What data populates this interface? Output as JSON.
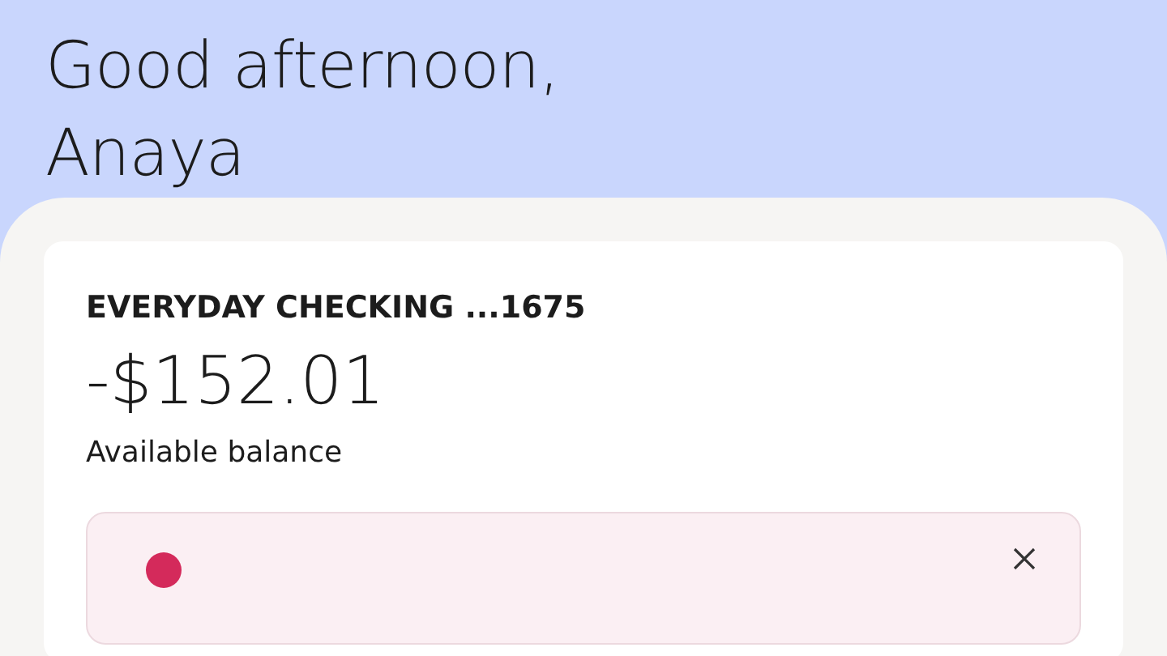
{
  "greeting": {
    "lines": [
      "Good afternoon,",
      "Anaya"
    ]
  },
  "account_card": {
    "title": "EVERYDAY CHECKING ...1675",
    "balance": "-$152.01",
    "balance_label": "Available balance"
  },
  "alert": {
    "dismissible": true
  }
}
